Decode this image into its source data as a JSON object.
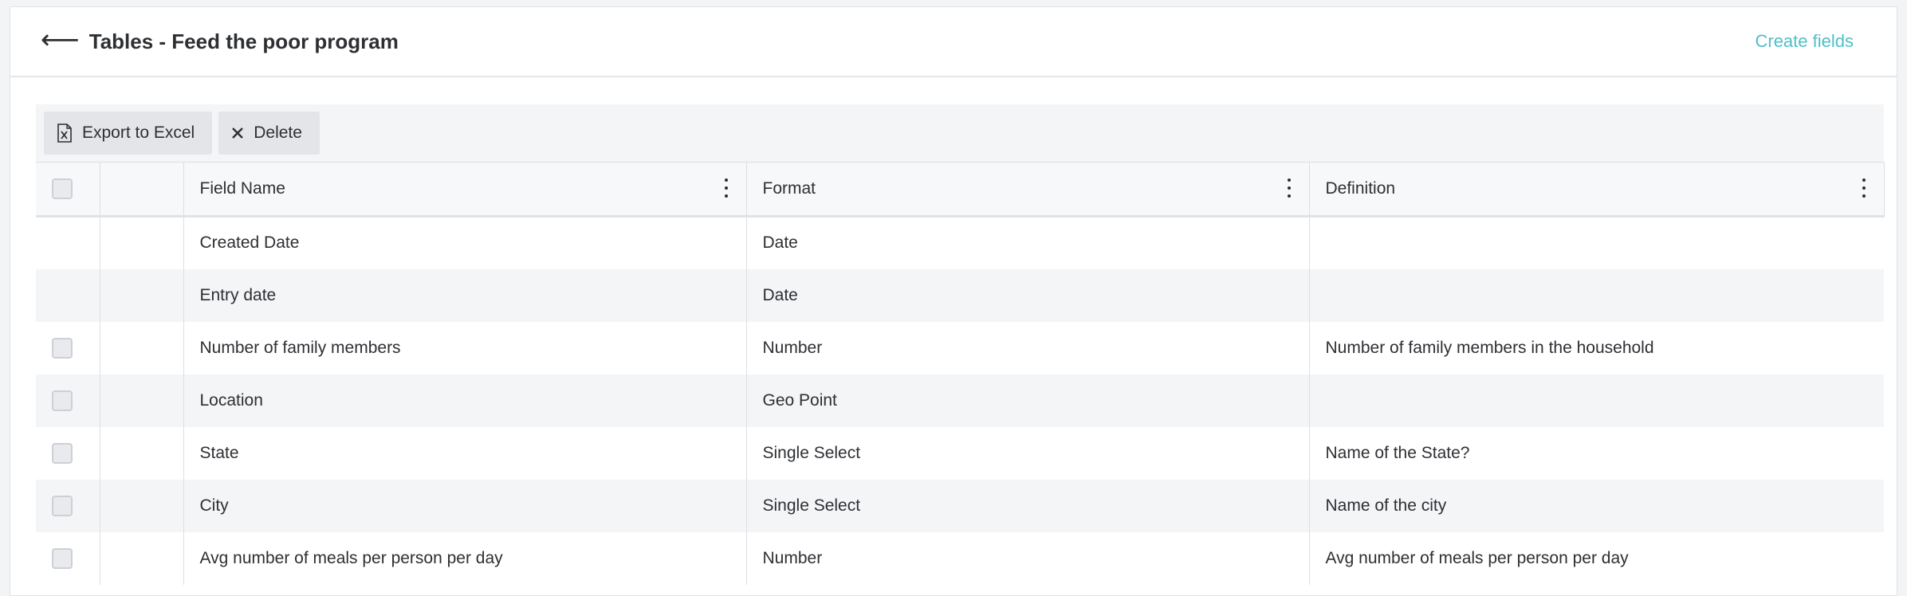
{
  "header": {
    "back_icon": "arrow-left-icon",
    "title": "Tables - Feed the poor program",
    "create_link": "Create fields"
  },
  "toolbar": {
    "export_label": "Export to Excel",
    "export_icon": "excel-file-icon",
    "delete_label": "Delete",
    "delete_icon": "close-icon"
  },
  "table": {
    "columns": [
      "Field Name",
      "Format",
      "Definition"
    ],
    "rows": [
      {
        "field": "Created Date",
        "format": "Date",
        "definition": "",
        "selectable": false
      },
      {
        "field": "Entry date",
        "format": "Date",
        "definition": "",
        "selectable": false
      },
      {
        "field": "Number of family members",
        "format": "Number",
        "definition": "Number of family members in the household",
        "selectable": true
      },
      {
        "field": "Location",
        "format": "Geo Point",
        "definition": "",
        "selectable": true
      },
      {
        "field": "State",
        "format": "Single Select",
        "definition": "Name of the State?",
        "selectable": true
      },
      {
        "field": "City",
        "format": "Single Select",
        "definition": "Name of the city",
        "selectable": true
      },
      {
        "field": "Avg number of meals per person per day",
        "format": "Number",
        "definition": "Avg number of meals per person per day",
        "selectable": true
      }
    ]
  },
  "colors": {
    "accent": "#4fbfc7",
    "text": "#2d2f33",
    "toolbar_bg": "#f4f5f7",
    "button_bg": "#e3e5e9"
  }
}
